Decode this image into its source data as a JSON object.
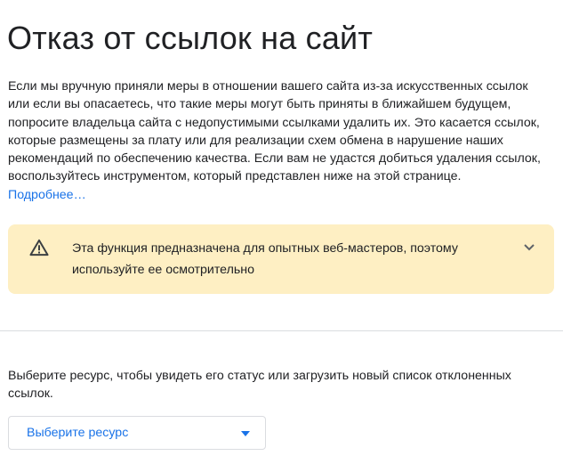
{
  "page": {
    "title": "Отказ от ссылок на сайт"
  },
  "intro": {
    "text": "Если мы вручную приняли меры в отношении вашего сайта из-за искусственных ссылок или если вы опасаетесь, что такие меры могут быть приняты в ближайшем будущем, попросите владельца сайта с недопустимыми ссылками удалить их. Это касается ссылок, которые размещены за плату или для реализации схем обмена в нарушение наших рекомендаций по обеспечению качества. Если вам не удастся добиться удаления ссылок, воспользуйтесь инструментом, который представлен ниже на этой странице. ",
    "learn_more_label": "Подробнее…"
  },
  "warning": {
    "icon": "warning-triangle-icon",
    "text": "Эта функция предназначена для опытных веб-мастеров, поэтому используйте ее осмотрительно",
    "expand_icon": "chevron-down-icon",
    "background_color": "#feefc3"
  },
  "resource": {
    "hint": "Выберите ресурс, чтобы увидеть его статус или загрузить новый список отклоненных ссылок.",
    "select_label": "Выберите ресурс",
    "accent_color": "#1a73e8"
  }
}
